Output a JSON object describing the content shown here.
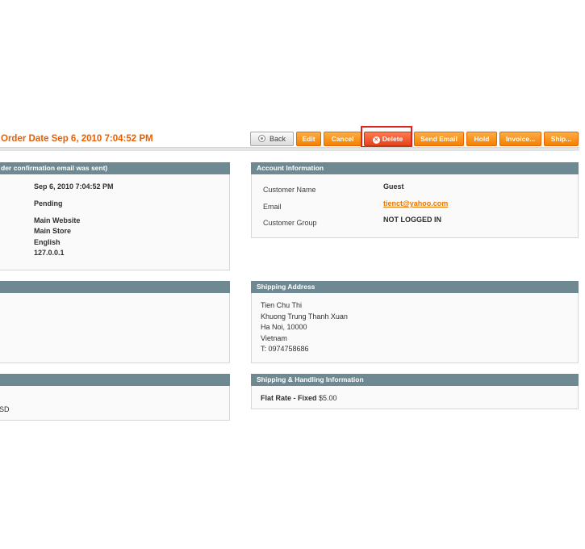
{
  "page_title": "Order Date Sep 6, 2010 7:04:52 PM",
  "toolbar": {
    "back": "Back",
    "edit": "Edit",
    "cancel": "Cancel",
    "delete": "Delete",
    "send_email": "Send Email",
    "hold": "Hold",
    "invoice": "Invoice...",
    "ship": "Ship..."
  },
  "order_info": {
    "header": "der confirmation email was sent)",
    "values": [
      "Sep 6, 2010 7:04:52 PM",
      "Pending",
      "Main Website",
      "Main Store",
      "English",
      "127.0.0.1"
    ]
  },
  "account_info": {
    "header": "Account Information",
    "customer_name_label": "Customer Name",
    "customer_name": "Guest",
    "email_label": "Email",
    "email": "tienct@yahoo.com",
    "customer_group_label": "Customer Group",
    "customer_group": "NOT LOGGED IN"
  },
  "shipping_address": {
    "header": "Shipping Address",
    "lines": [
      "Tien Chu Thi",
      "Khuong Trung Thanh Xuan",
      "Ha Noi, 10000",
      "Vietnam",
      "T: 0974758686"
    ]
  },
  "shipping_handling": {
    "header": "Shipping & Handling Information",
    "method": "Flat Rate - Fixed",
    "price": "$5.00"
  },
  "payment_info": {
    "fragment": "SD"
  }
}
